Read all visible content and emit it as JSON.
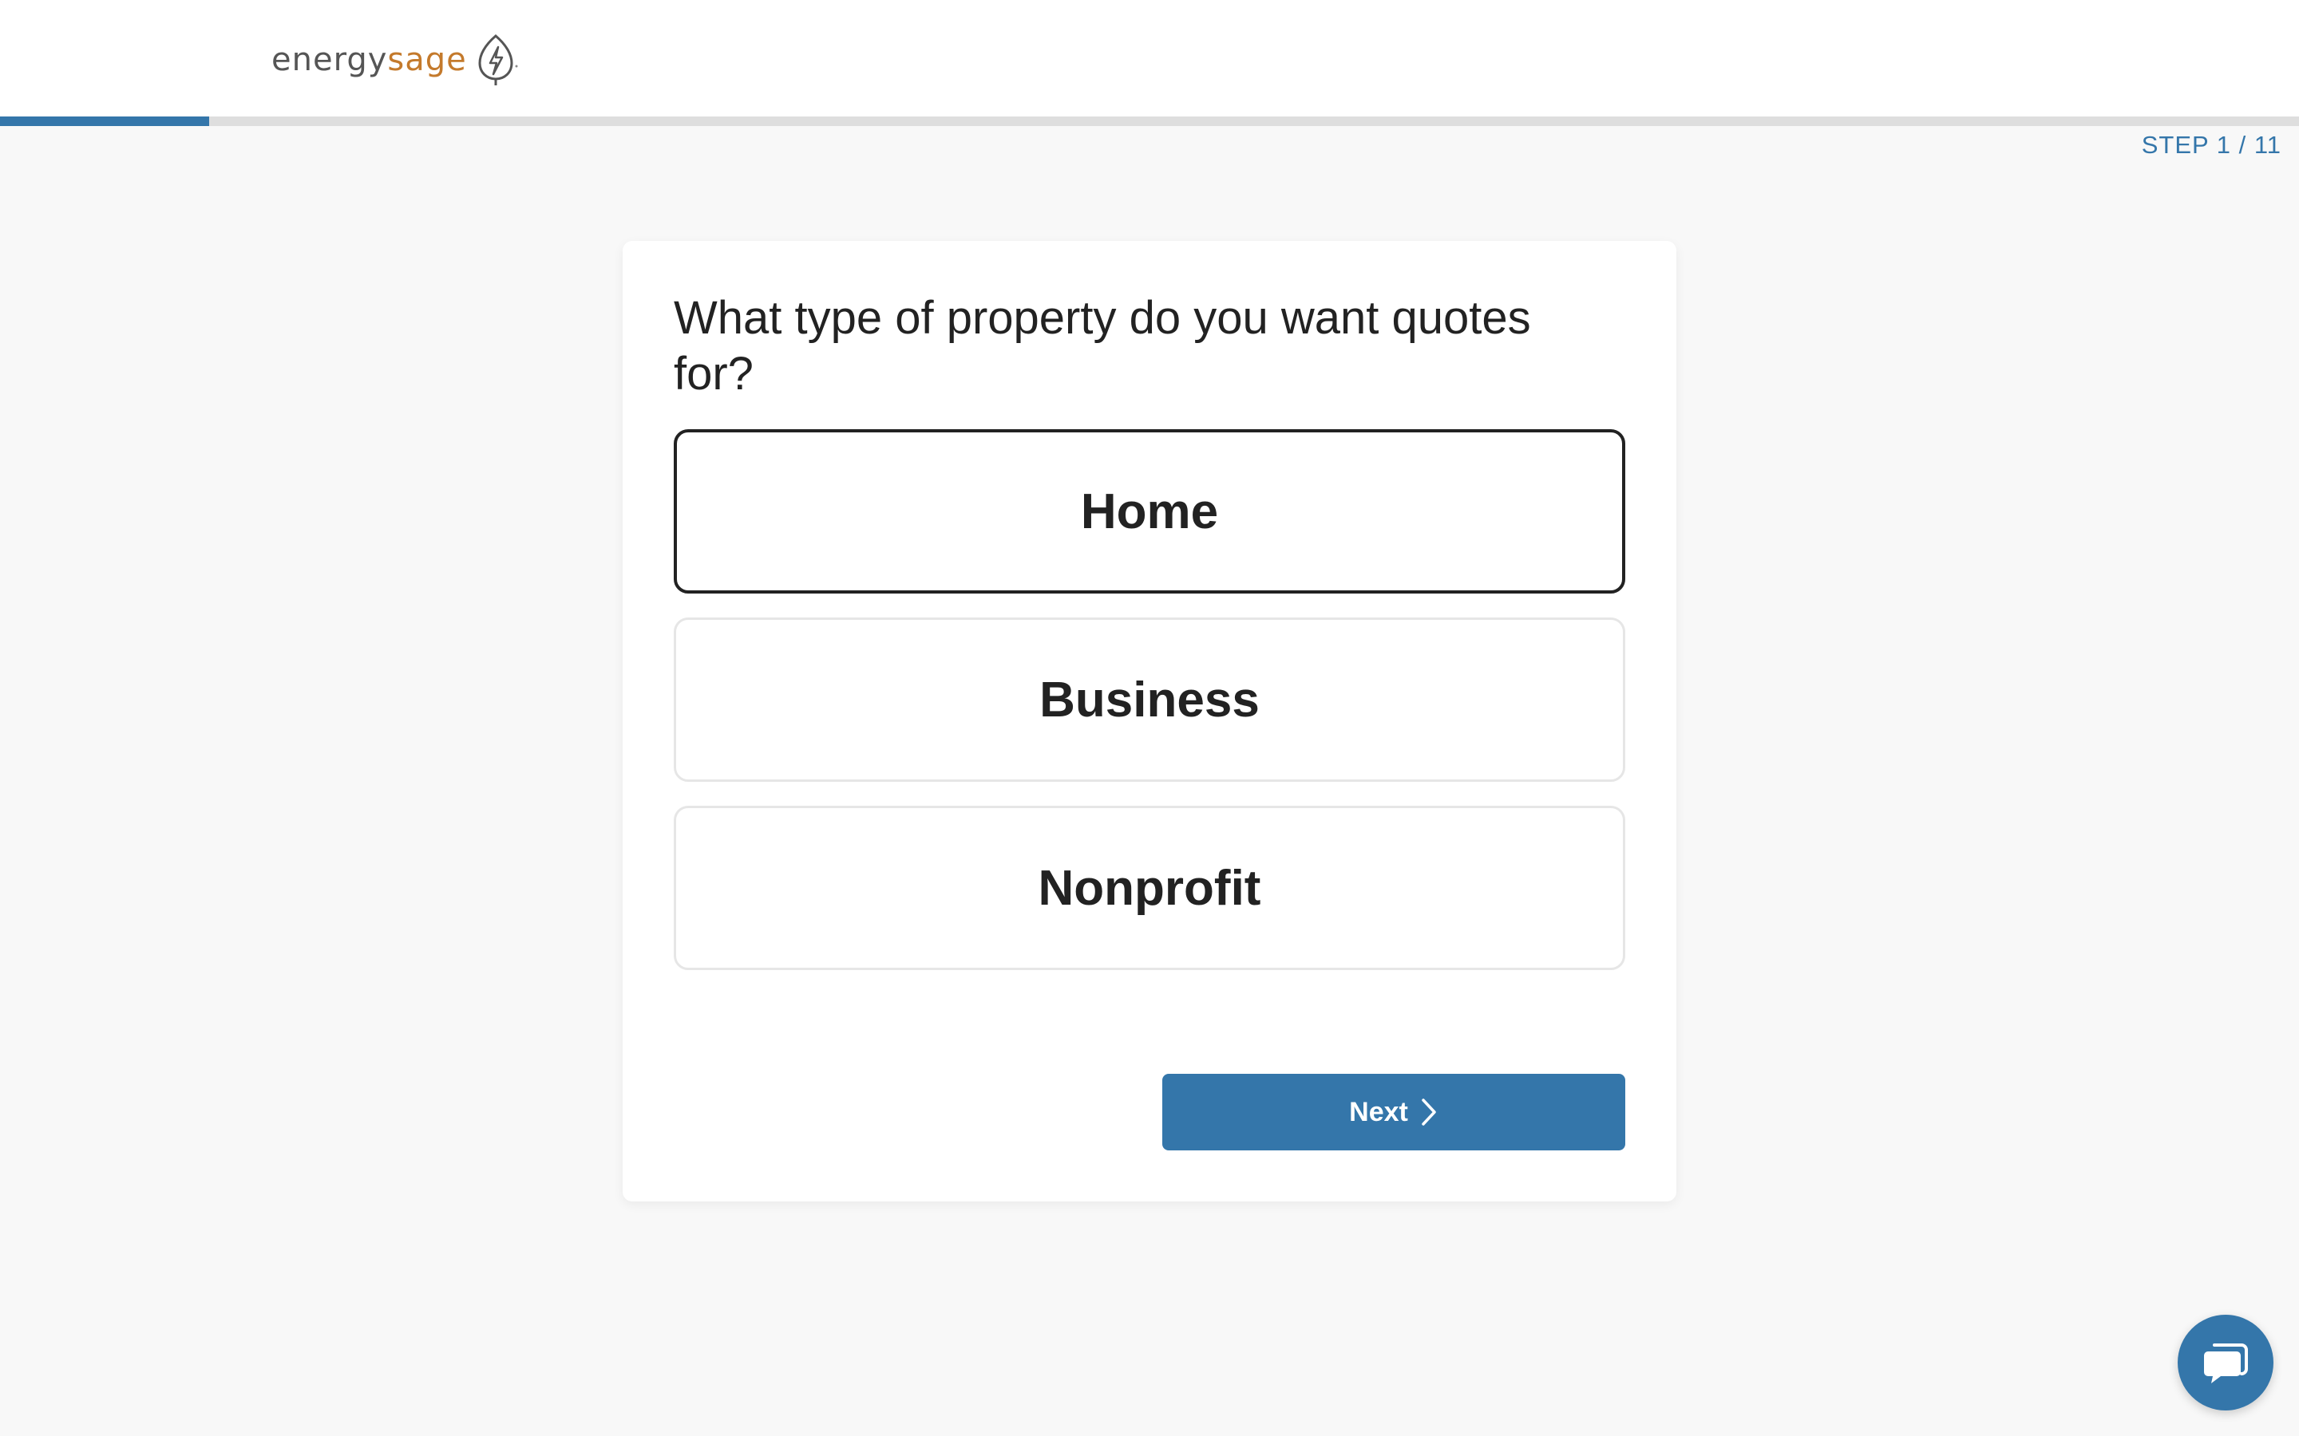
{
  "header": {
    "logo_part1": "energy",
    "logo_part2": "sage",
    "logo_icon": "leaf-bolt-icon"
  },
  "progress": {
    "step_label": "STEP 1 / 11",
    "current_step": 1,
    "total_steps": 11,
    "fraction": 0.0909
  },
  "question": {
    "text": "What type of property do you want quotes for?"
  },
  "options": [
    {
      "label": "Home",
      "selected": true
    },
    {
      "label": "Business",
      "selected": false
    },
    {
      "label": "Nonprofit",
      "selected": false
    }
  ],
  "actions": {
    "next_label": "Next",
    "next_icon": "chevron-right-icon"
  },
  "chat": {
    "icon": "chat-bubble-icon"
  },
  "colors": {
    "accent": "#3476aa",
    "brand_orange": "#c47a2c",
    "background": "#f8f8f8",
    "text": "#222222"
  }
}
